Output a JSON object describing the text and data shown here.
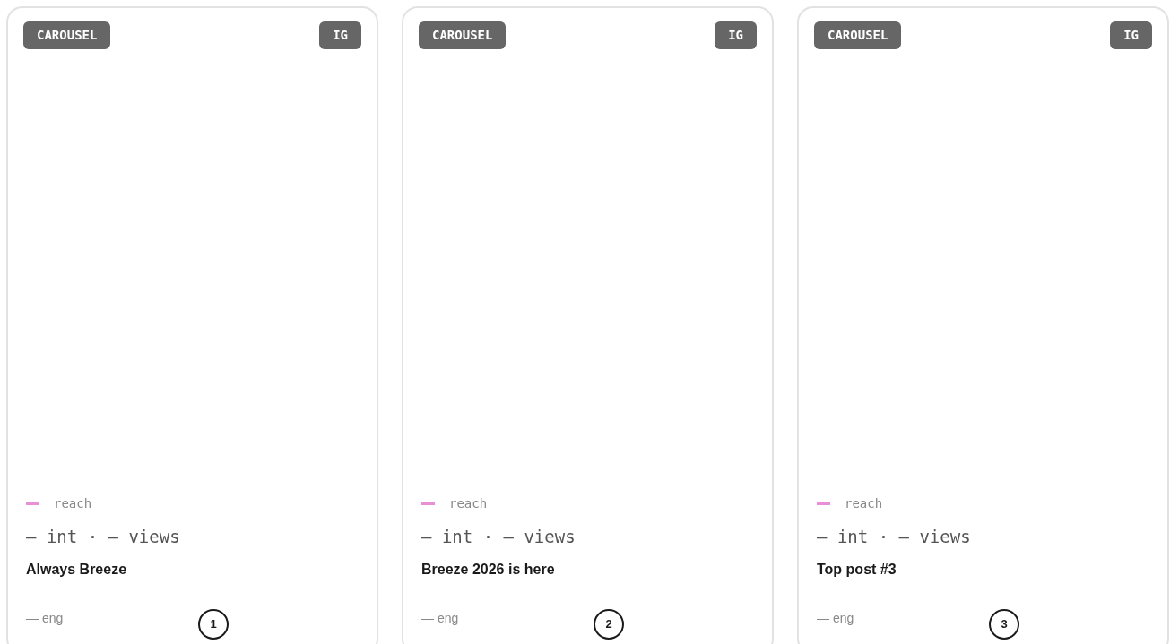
{
  "cards": [
    {
      "format": "CAROUSEL",
      "platform": "IG",
      "color": "#e88fd6",
      "reach": "reach",
      "stats": "— int · — views",
      "title": "Always Breeze",
      "eng": "— eng",
      "number": "1"
    },
    {
      "format": "CAROUSEL",
      "platform": "IG",
      "color": "#e88fd6",
      "reach": "reach",
      "stats": "— int · — views",
      "title": "Breeze 2026 is here",
      "eng": "— eng",
      "number": "2"
    },
    {
      "format": "CAROUSEL",
      "platform": "IG",
      "color": "#e88fd6",
      "reach": "reach",
      "stats": "— int · — views",
      "title": "Top post #3",
      "eng": "— eng",
      "number": "3"
    }
  ]
}
